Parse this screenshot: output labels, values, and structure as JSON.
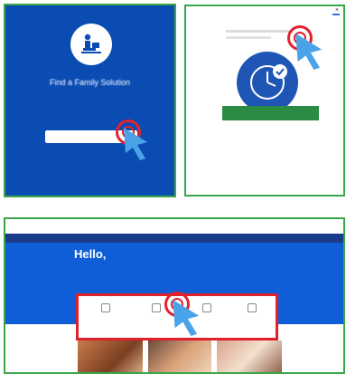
{
  "colors": {
    "panel_border": "#3aa64a",
    "panel_a_bg": "#0b4cb3",
    "hero_blue": "#0f5ed8",
    "nav_dark": "#1a3a8a",
    "green_button": "#2b8a43",
    "click_ring": "#e3222c",
    "pointer": "#4aa3e8"
  },
  "panel_a": {
    "logo_icon": "person-at-desk-icon",
    "title": "Find a Family Solution",
    "para1": "",
    "para2": "",
    "cta_label": ""
  },
  "panel_b": {
    "header_title": "",
    "close_symbol": "×",
    "circle_icon": "clock-check-icon",
    "button_label": "",
    "sub_link": ""
  },
  "panel_c": {
    "brand": "",
    "nav_left": "",
    "nav_right": "",
    "hello": "Hello,",
    "question": "",
    "options": [
      {
        "label": "",
        "icon": "option-1-icon"
      },
      {
        "label": "",
        "icon": "option-2-icon"
      },
      {
        "label": "",
        "icon": "option-3-icon"
      },
      {
        "label": "",
        "icon": "option-4-icon"
      }
    ],
    "options_foot_left": "",
    "options_foot_right": "",
    "section_title": ""
  }
}
